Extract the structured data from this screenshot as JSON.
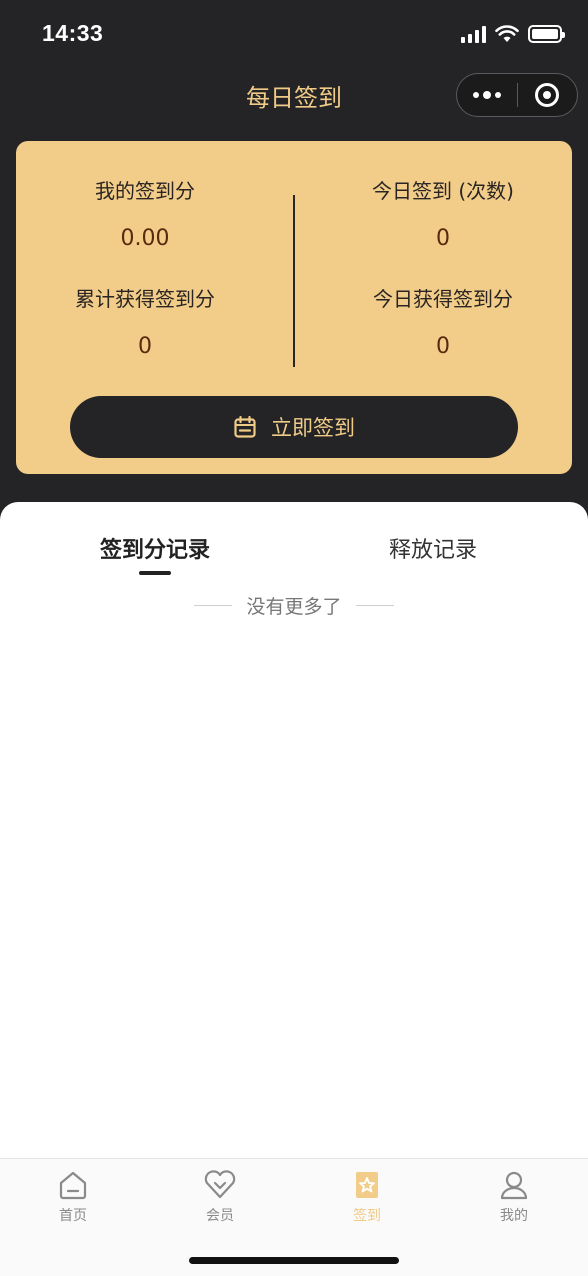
{
  "status_bar": {
    "time": "14:33"
  },
  "nav": {
    "title": "每日签到"
  },
  "card": {
    "stats": [
      {
        "label": "我的签到分",
        "value": "0.00"
      },
      {
        "label": "今日签到 (次数)",
        "value": "0"
      },
      {
        "label": "累计获得签到分",
        "value": "0"
      },
      {
        "label": "今日获得签到分",
        "value": "0"
      }
    ],
    "checkin_button": {
      "label": "立即签到",
      "icon": "calendar-icon"
    }
  },
  "tabs": [
    {
      "label": "签到分记录",
      "active": true
    },
    {
      "label": "释放记录",
      "active": false
    }
  ],
  "list_status": "没有更多了",
  "tabbar": {
    "items": [
      {
        "label": "首页",
        "icon": "home-icon",
        "active": false
      },
      {
        "label": "会员",
        "icon": "member-heart-icon",
        "active": false
      },
      {
        "label": "签到",
        "icon": "checkin-star-icon",
        "active": true
      },
      {
        "label": "我的",
        "icon": "user-icon",
        "active": false
      }
    ]
  },
  "colors": {
    "dark_bg": "#242426",
    "gold": "#f2cd8a",
    "gold_text": "#f0cb87",
    "value_brown": "#5a2a0f"
  }
}
